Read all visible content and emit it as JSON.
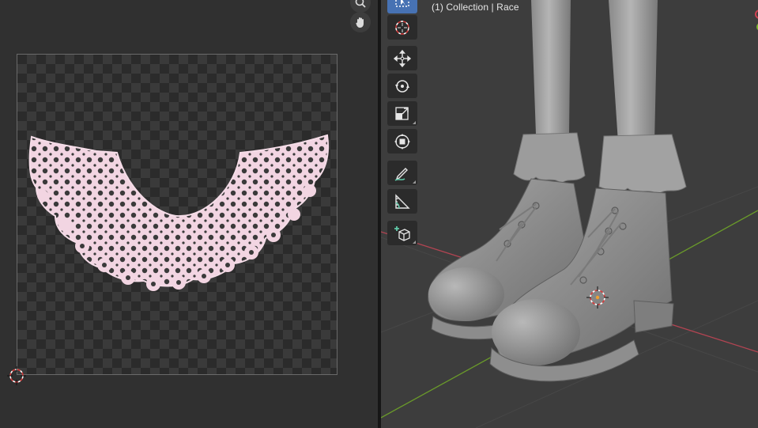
{
  "viewport": {
    "label": "(1) Collection | Race"
  },
  "image_editor": {
    "nav": [
      "zoom-icon",
      "hand-pan-icon"
    ]
  },
  "toolbar": {
    "tools": [
      {
        "name": "select-box-icon",
        "active": true
      },
      {
        "name": "cursor-icon",
        "active": false
      },
      {
        "name": "move-icon",
        "active": false
      },
      {
        "name": "rotate-icon",
        "active": false
      },
      {
        "name": "scale-icon",
        "active": false
      },
      {
        "name": "transform-icon",
        "active": false
      },
      {
        "name": "annotate-icon",
        "active": false
      },
      {
        "name": "measure-icon",
        "active": false
      },
      {
        "name": "add-cube-icon",
        "active": false
      }
    ]
  },
  "colors": {
    "lace": "#f2d5e2",
    "editor_bg": "#303030",
    "viewport_bg": "#3d3d3d",
    "active_tool": "#4772b3",
    "x_axis": "#b24452",
    "y_axis": "#6a9a2a"
  }
}
